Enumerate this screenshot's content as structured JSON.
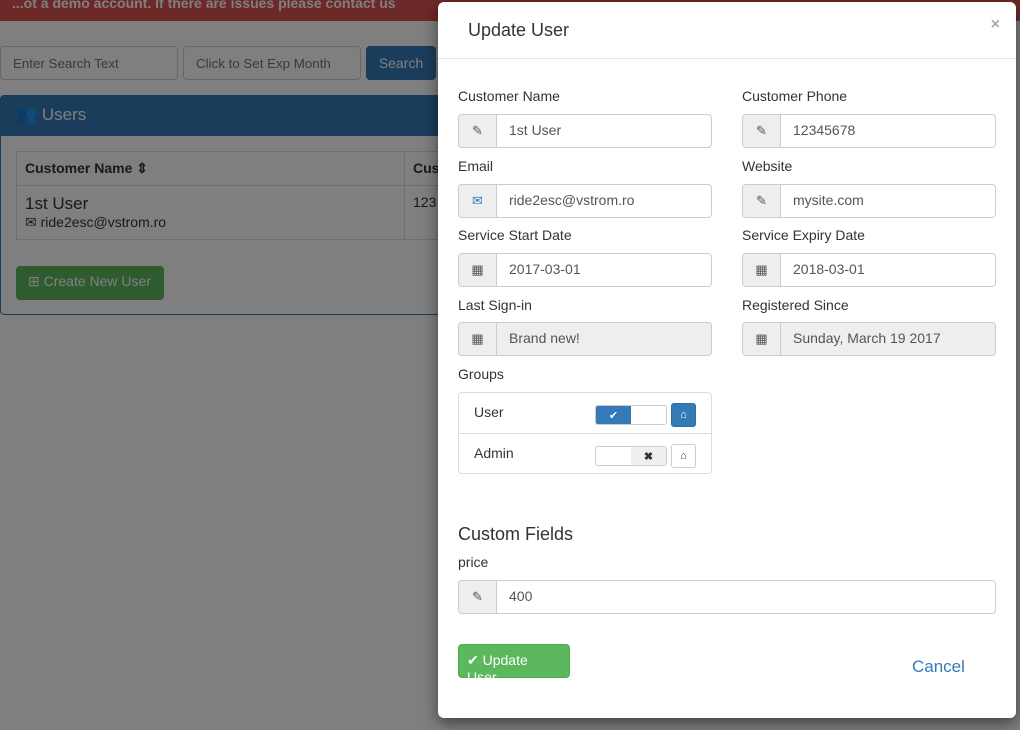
{
  "banner": {
    "text": "...ot a demo account. If there are issues please contact us"
  },
  "toolbar": {
    "search_placeholder": "Enter Search Text",
    "exp_placeholder": "Click to Set Exp Month",
    "search_label": "Search"
  },
  "panel": {
    "title": "Users",
    "columns": [
      "Customer Name",
      "Cus"
    ],
    "rows": [
      {
        "name": "1st User",
        "email": "ride2esc@vstrom.ro",
        "phone": "123"
      }
    ],
    "create_label": "Create New User"
  },
  "modal": {
    "title": "Update User",
    "close": "×",
    "fields": {
      "customer_name": {
        "label": "Customer Name",
        "value": "1st User"
      },
      "customer_phone": {
        "label": "Customer Phone",
        "value": "12345678"
      },
      "email": {
        "label": "Email",
        "value": "ride2esc@vstrom.ro"
      },
      "website": {
        "label": "Website",
        "value": "mysite.com"
      },
      "service_start": {
        "label": "Service Start Date",
        "value": "2017-03-01"
      },
      "service_expiry": {
        "label": "Service Expiry Date",
        "value": "2018-03-01"
      },
      "last_signin": {
        "label": "Last Sign-in",
        "value": "Brand new!"
      },
      "registered": {
        "label": "Registered Since",
        "value": "Sunday, March 19 2017"
      }
    },
    "groups": {
      "label": "Groups",
      "items": [
        {
          "name": "User",
          "enabled": true
        },
        {
          "name": "Admin",
          "enabled": false
        }
      ]
    },
    "custom_fields": {
      "title": "Custom Fields",
      "price": {
        "label": "price",
        "value": "400"
      }
    },
    "update_label": "Update User",
    "cancel_label": "Cancel"
  },
  "colors": {
    "primary": "#337ab7",
    "success": "#5cb85c",
    "danger": "#d9534f"
  }
}
